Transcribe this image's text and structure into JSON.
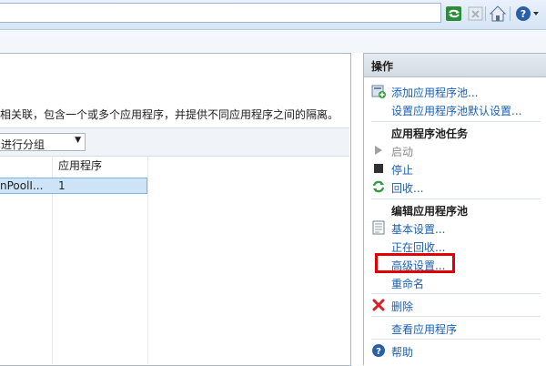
{
  "toolbar": {
    "icons": [
      "refresh-icon",
      "stop-icon",
      "home-icon",
      "help-icon"
    ]
  },
  "main": {
    "description": "相关联，包含一个或多个应用程序，并提供不同应用程序之间的隔离。",
    "group_by_value": "进行分组",
    "column_app": "应用程序",
    "row_name": "nPoolI...",
    "row_apps": "1"
  },
  "actions": {
    "title": "操作",
    "add_pool": "添加应用程序池...",
    "set_defaults": "设置应用程序池默认设置...",
    "tasks_heading": "应用程序池任务",
    "start": "启动",
    "stop": "停止",
    "recycle": "回收...",
    "edit_heading": "编辑应用程序池",
    "basic_settings": "基本设置...",
    "recycling": "正在回收...",
    "advanced_settings": "高级设置...",
    "rename": "重命名",
    "delete": "删除",
    "view_apps": "查看应用程序",
    "help": "帮助"
  }
}
